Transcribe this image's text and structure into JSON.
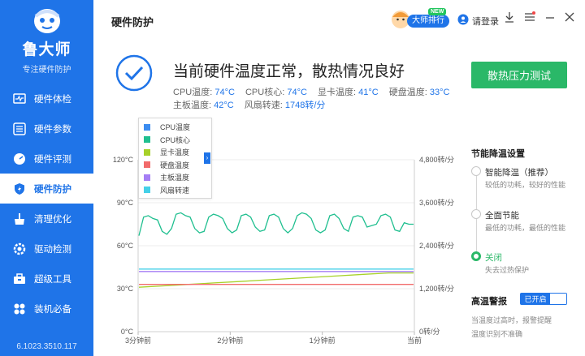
{
  "sidebar": {
    "app_name": "鲁大师",
    "app_sub": "专注硬件防护",
    "items": [
      {
        "label": "硬件体检",
        "icon": "monitor-pulse-icon"
      },
      {
        "label": "硬件参数",
        "icon": "sliders-icon"
      },
      {
        "label": "硬件评测",
        "icon": "gauge-icon"
      },
      {
        "label": "硬件防护",
        "icon": "shield-bolt-icon"
      },
      {
        "label": "清理优化",
        "icon": "broom-icon"
      },
      {
        "label": "驱动检测",
        "icon": "gear-icon"
      },
      {
        "label": "超级工具",
        "icon": "toolbox-icon"
      },
      {
        "label": "装机必备",
        "icon": "apps-icon"
      }
    ],
    "active_index": 3,
    "version": "6.1023.3510.117"
  },
  "topbar": {
    "title": "硬件防护",
    "rank_label": "大师排行",
    "new_tag": "NEW",
    "login_label": "请登录"
  },
  "status": {
    "title": "当前硬件温度正常，散热情况良好",
    "row1": [
      {
        "label": "CPU温度:",
        "value": "74°C"
      },
      {
        "label": "CPU核心:",
        "value": "74°C"
      },
      {
        "label": "显卡温度:",
        "value": "41°C"
      },
      {
        "label": "硬盘温度:",
        "value": "33°C"
      }
    ],
    "row2": [
      {
        "label": "主板温度:",
        "value": "42°C"
      },
      {
        "label": "风扇转速:",
        "value": "1748转/分"
      }
    ]
  },
  "stress_button": "散热压力测试",
  "legend": {
    "items": [
      {
        "label": "CPU温度",
        "color": "#3b8cf0"
      },
      {
        "label": "CPU核心",
        "color": "#1fbf8f"
      },
      {
        "label": "显卡温度",
        "color": "#a7d129"
      },
      {
        "label": "硬盘温度",
        "color": "#f26b6b"
      },
      {
        "label": "主板温度",
        "color": "#a57ef5"
      },
      {
        "label": "风扇转速",
        "color": "#45d0e8"
      }
    ],
    "collapse_glyph": "›"
  },
  "chart_data": {
    "type": "line",
    "x_ticks": [
      "3分钟前",
      "2分钟前",
      "1分钟前",
      "当前"
    ],
    "y_left": {
      "ticks": [
        "0°C",
        "30°C",
        "60°C",
        "90°C",
        "120°C"
      ],
      "ylim": [
        0,
        120
      ]
    },
    "y_right": {
      "ticks": [
        "0转/分",
        "1,200转/分",
        "2,400转/分",
        "3,600转/分",
        "4,800转/分"
      ],
      "ylim": [
        0,
        4800
      ]
    },
    "series": [
      {
        "name": "CPU核心",
        "color": "#1fbf8f",
        "axis": "left",
        "values": [
          67,
          80,
          81,
          79,
          78,
          70,
          68,
          72,
          82,
          83,
          81,
          80,
          72,
          69,
          70,
          80,
          82,
          81,
          79,
          72,
          69,
          71,
          81,
          82,
          80,
          73,
          70,
          71,
          81,
          82,
          80,
          72,
          69,
          72,
          81,
          83,
          82,
          79,
          71,
          69,
          71,
          81,
          82,
          79,
          72,
          70,
          80,
          81,
          80,
          73,
          74,
          75,
          81,
          82,
          80,
          71,
          70,
          76,
          75,
          75
        ]
      },
      {
        "name": "主板温度",
        "color": "#a57ef5",
        "axis": "left",
        "values": [
          42,
          42
        ]
      },
      {
        "name": "显卡温度",
        "color": "#a7d129",
        "axis": "left",
        "values": [
          31,
          32,
          33,
          34,
          35,
          36,
          37,
          38,
          39,
          40,
          41,
          41
        ]
      },
      {
        "name": "硬盘温度",
        "color": "#f26b6b",
        "axis": "left",
        "values": [
          33,
          33
        ]
      },
      {
        "name": "风扇转速",
        "color": "#45d0e8",
        "axis": "right",
        "values": [
          1748,
          1748
        ]
      }
    ],
    "grid": true
  },
  "right_panel": {
    "power_title": "节能降温设置",
    "options": [
      {
        "label": "智能降温（推荐）",
        "desc": "较低的功耗，较好的性能",
        "selected": false
      },
      {
        "label": "全面节能",
        "desc": "最低的功耗，最低的性能",
        "selected": false
      },
      {
        "label": "关闭",
        "desc": "失去过热保护",
        "selected": true
      }
    ],
    "warn_title": "高温警报",
    "toggle_label": "已开启",
    "warn_desc1": "当温度过高时，报警提醒",
    "warn_desc2": "温度识别不准确"
  },
  "colors": {
    "brand": "#1f74e8",
    "accent_green": "#2ab868"
  }
}
